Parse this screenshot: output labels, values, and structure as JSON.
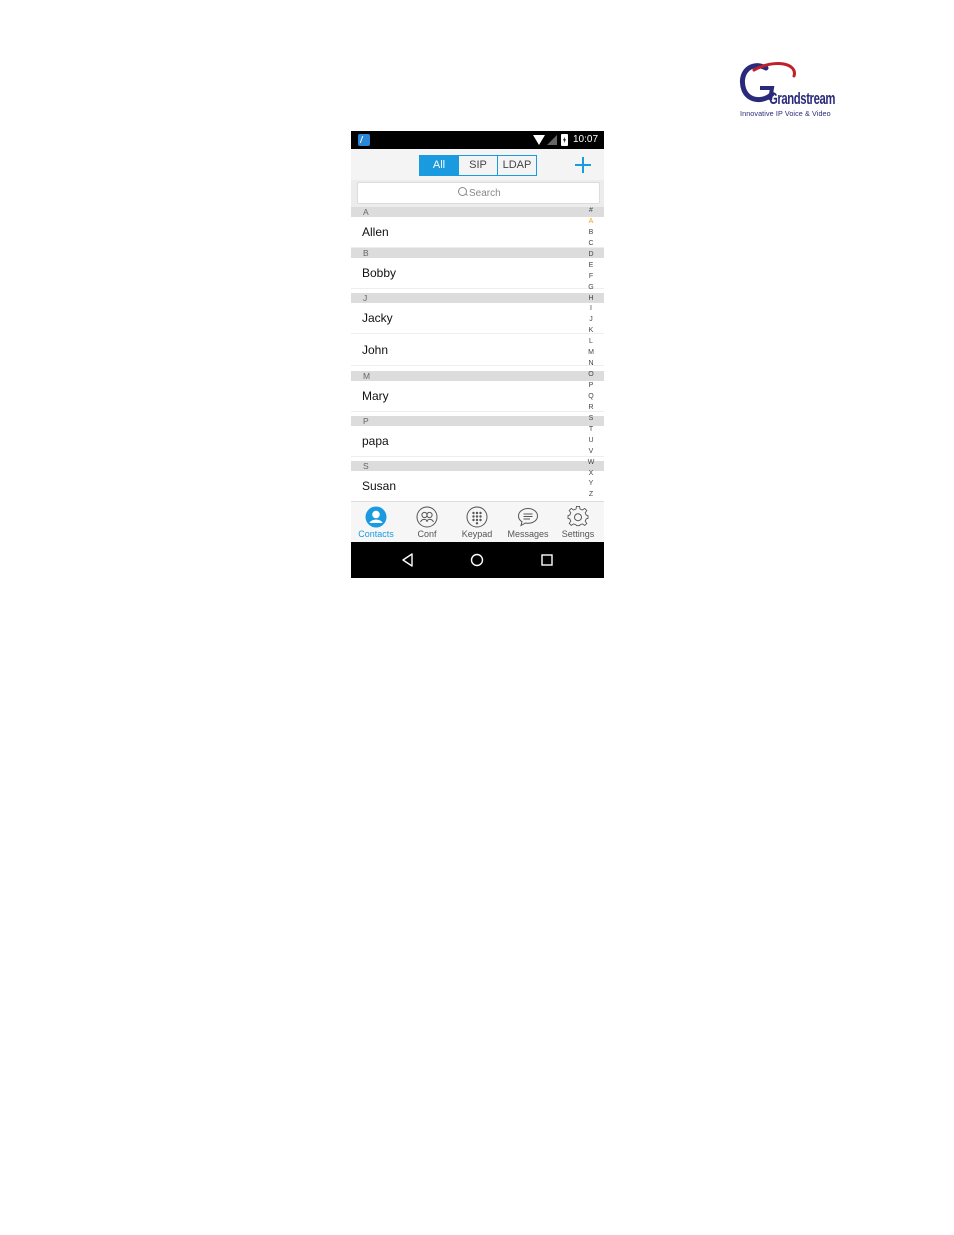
{
  "brand": {
    "name": "Grandstream",
    "tagline": "Innovative IP Voice & Video",
    "colors": {
      "primary": "#2a2a7a",
      "swoosh": "#c0202c"
    }
  },
  "status_bar": {
    "time": "10:07",
    "icons": [
      "app-badge-icon",
      "wifi-icon",
      "signal-icon",
      "battery-icon"
    ]
  },
  "tabs": [
    {
      "label": "All",
      "active": true
    },
    {
      "label": "SIP",
      "active": false
    },
    {
      "label": "LDAP",
      "active": false
    }
  ],
  "add_icon": "plus-icon",
  "search": {
    "placeholder": "Search"
  },
  "contacts": [
    {
      "letter": "A",
      "names": [
        "Allen"
      ]
    },
    {
      "letter": "B",
      "names": [
        "Bobby"
      ]
    },
    {
      "letter": "J",
      "names": [
        "Jacky",
        "John"
      ]
    },
    {
      "letter": "M",
      "names": [
        "Mary"
      ]
    },
    {
      "letter": "P",
      "names": [
        "papa"
      ]
    },
    {
      "letter": "S",
      "names": [
        "Susan"
      ]
    }
  ],
  "alphabet_index": [
    "#",
    "A",
    "B",
    "C",
    "D",
    "E",
    "F",
    "G",
    "H",
    "I",
    "J",
    "K",
    "L",
    "M",
    "N",
    "O",
    "P",
    "Q",
    "R",
    "S",
    "T",
    "U",
    "V",
    "W",
    "X",
    "Y",
    "Z"
  ],
  "alphabet_active": "A",
  "bottom_nav": [
    {
      "label": "Contacts",
      "icon": "contacts-icon",
      "active": true
    },
    {
      "label": "Conf",
      "icon": "conference-icon",
      "active": false
    },
    {
      "label": "Keypad",
      "icon": "keypad-icon",
      "active": false
    },
    {
      "label": "Messages",
      "icon": "messages-icon",
      "active": false
    },
    {
      "label": "Settings",
      "icon": "settings-icon",
      "active": false
    }
  ],
  "system_nav": [
    "back-icon",
    "home-icon",
    "recents-icon"
  ],
  "accent_color": "#1a9be0",
  "index_highlight_color": "#f5a020"
}
